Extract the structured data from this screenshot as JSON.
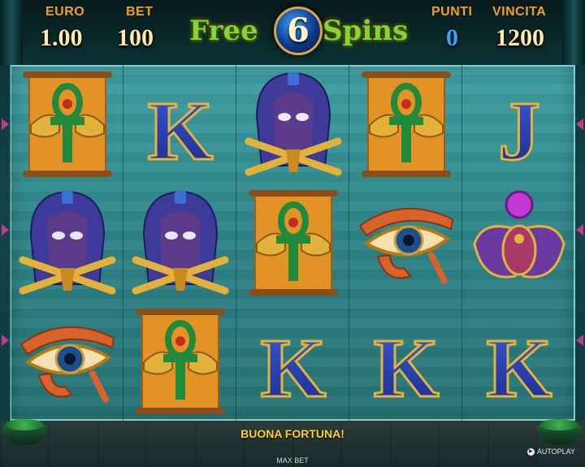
{
  "hud": {
    "euro_label": "EURO",
    "euro_value": "1.00",
    "bet_label": "BET",
    "bet_value": "100",
    "punti_label": "PUNTI",
    "punti_value": "0",
    "vincita_label": "VINCITA",
    "vincita_value": "1200"
  },
  "logo": {
    "free": "Free",
    "number": "6",
    "spins": "Spins"
  },
  "grid": {
    "columns": 5,
    "rows": 3,
    "symbols": [
      [
        "ankh-scroll",
        "pharaoh",
        "eye-of-horus"
      ],
      [
        "k",
        "pharaoh",
        "ankh-scroll"
      ],
      [
        "pharaoh",
        "ankh-scroll",
        "k"
      ],
      [
        "ankh-scroll",
        "eye-of-horus",
        "k"
      ],
      [
        "j",
        "scarab",
        "k"
      ]
    ]
  },
  "letters": {
    "k": "K",
    "j": "J"
  },
  "colors": {
    "accent_gold": "#f0a020",
    "value_text": "#ffe9a8",
    "punti_blue": "#2fa7ff",
    "logo_green": "#86d431",
    "message_yellow": "#ffd21e",
    "reel_teal": "#3f9fa3"
  },
  "footer": {
    "message": "BUONA FORTUNA!",
    "autoplay_label": "AUTOPLAY",
    "maxbet_label": "MAX BET"
  }
}
